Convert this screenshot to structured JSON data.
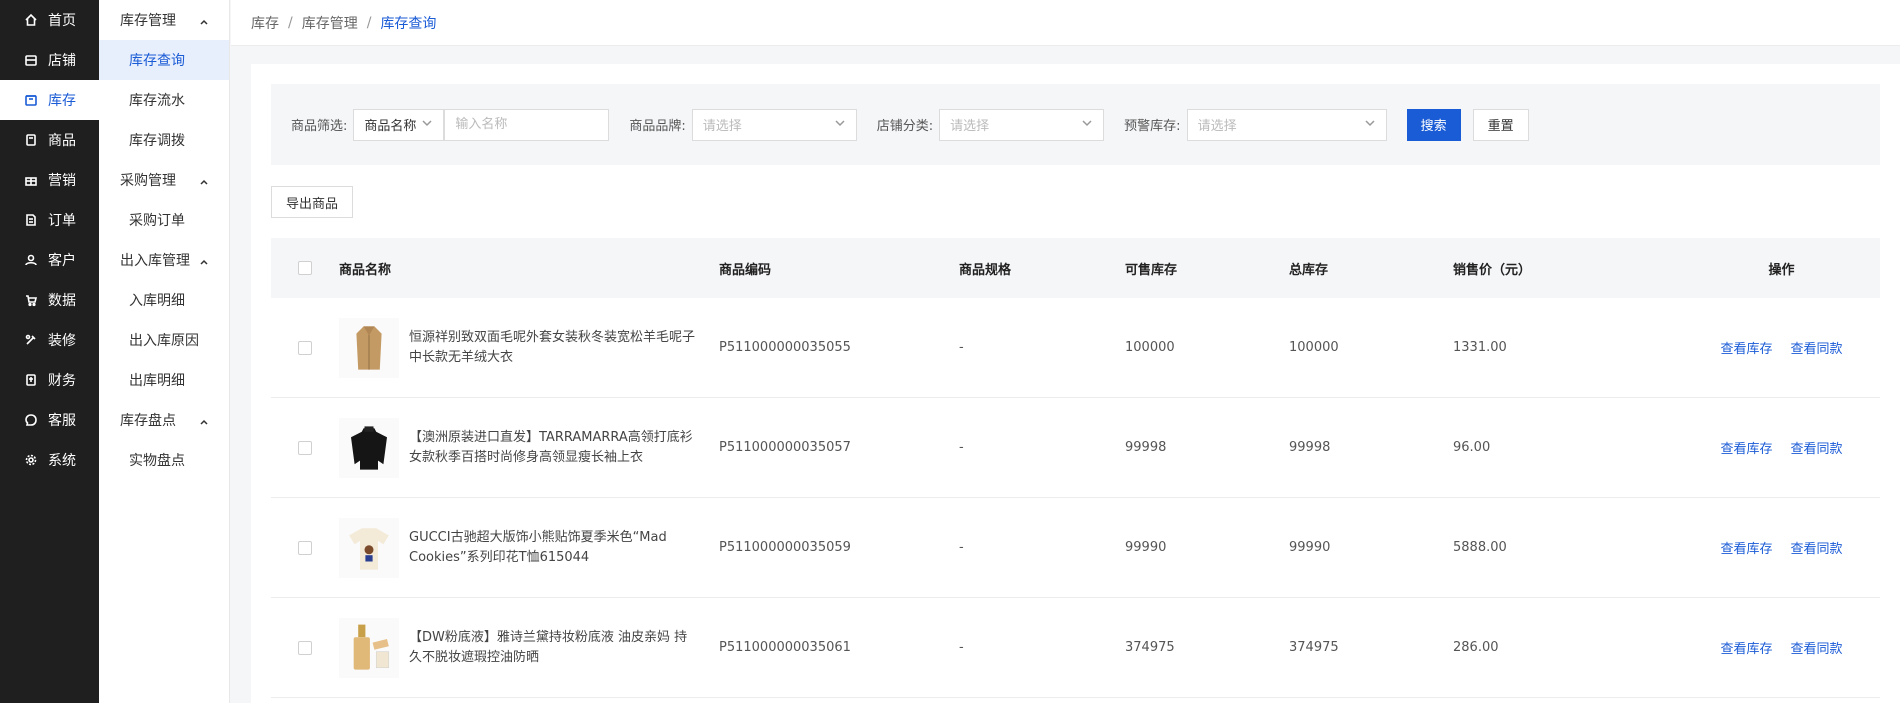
{
  "nav_primary": [
    {
      "label": "首页",
      "icon": "home-icon"
    },
    {
      "label": "店铺",
      "icon": "store-icon"
    },
    {
      "label": "库存",
      "icon": "box-icon",
      "active": true
    },
    {
      "label": "商品",
      "icon": "tag-icon"
    },
    {
      "label": "营销",
      "icon": "gift-icon"
    },
    {
      "label": "订单",
      "icon": "document-icon"
    },
    {
      "label": "客户",
      "icon": "users-icon"
    },
    {
      "label": "数据",
      "icon": "cart-icon"
    },
    {
      "label": "装修",
      "icon": "brush-icon"
    },
    {
      "label": "财务",
      "icon": "wallet-icon"
    },
    {
      "label": "客服",
      "icon": "chat-icon"
    },
    {
      "label": "系统",
      "icon": "gear-icon"
    }
  ],
  "nav_secondary": [
    {
      "type": "group",
      "label": "库存管理"
    },
    {
      "type": "item",
      "label": "库存查询",
      "active": true
    },
    {
      "type": "item",
      "label": "库存流水"
    },
    {
      "type": "item",
      "label": "库存调拨"
    },
    {
      "type": "group",
      "label": "采购管理"
    },
    {
      "type": "item",
      "label": "采购订单"
    },
    {
      "type": "group",
      "label": "出入库管理"
    },
    {
      "type": "item",
      "label": "入库明细"
    },
    {
      "type": "item",
      "label": "出入库原因"
    },
    {
      "type": "item",
      "label": "出库明细"
    },
    {
      "type": "group",
      "label": "库存盘点"
    },
    {
      "type": "item",
      "label": "实物盘点"
    }
  ],
  "breadcrumb": {
    "a": "库存",
    "b": "库存管理",
    "c": "库存查询",
    "sep": "/"
  },
  "filter": {
    "goods_label": "商品筛选:",
    "goods_type_value": "商品名称",
    "goods_input_placeholder": "输入名称",
    "brand_label": "商品品牌:",
    "brand_placeholder": "请选择",
    "shop_cat_label": "店铺分类:",
    "shop_cat_placeholder": "请选择",
    "alert_label": "预警库存:",
    "alert_placeholder": "请选择",
    "search_label": "搜索",
    "reset_label": "重置"
  },
  "export_label": "导出商品",
  "table": {
    "headers": {
      "name": "商品名称",
      "code": "商品编码",
      "spec": "商品规格",
      "avail": "可售库存",
      "total": "总库存",
      "price": "销售价（元）",
      "ops": "操作"
    },
    "op_view_stock": "查看库存",
    "op_view_same": "查看同款",
    "rows": [
      {
        "name": "恒源祥别致双面毛呢外套女装秋冬装宽松羊毛呢子中长款无羊绒大衣",
        "code": "P511000000035055",
        "spec": "-",
        "avail": "100000",
        "total": "100000",
        "price": "1331.00",
        "thumb": "coat"
      },
      {
        "name": "【澳洲原装进口直发】TARRAMARRA高领打底衫女款秋季百搭时尚修身高领显瘦长袖上衣",
        "code": "P511000000035057",
        "spec": "-",
        "avail": "99998",
        "total": "99998",
        "price": "96.00",
        "thumb": "sweater"
      },
      {
        "name": "GUCCI古驰超大版饰小熊贴饰夏季米色“Mad Cookies”系列印花T恤615044",
        "code": "P511000000035059",
        "spec": "-",
        "avail": "99990",
        "total": "99990",
        "price": "5888.00",
        "thumb": "tshirt"
      },
      {
        "name": "【DW粉底液】雅诗兰黛持妆粉底液 油皮亲妈 持久不脱妆遮瑕控油防晒",
        "code": "P511000000035061",
        "spec": "-",
        "avail": "374975",
        "total": "374975",
        "price": "286.00",
        "thumb": "bottle"
      }
    ]
  },
  "colors": {
    "accent": "#1a5bd6",
    "sidebar_bg": "#1f1f1f",
    "active_bg": "#e8effc"
  }
}
